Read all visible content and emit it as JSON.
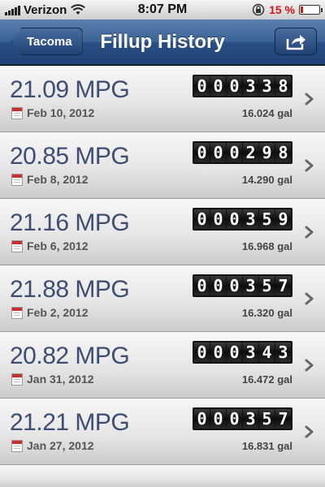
{
  "status_bar": {
    "carrier": "Verizon",
    "time": "8:07 PM",
    "battery_percent": "15 %",
    "battery_level": 0.15,
    "battery_color": "#d01818"
  },
  "nav": {
    "back_label": "Tacoma",
    "title": "Fillup History",
    "share_icon": "share-icon"
  },
  "fillups": [
    {
      "mpg": "21.09 MPG",
      "date": "Feb 10, 2012",
      "odometer": "000338",
      "gallons": "16.024 gal"
    },
    {
      "mpg": "20.85 MPG",
      "date": "Feb 8, 2012",
      "odometer": "000298",
      "gallons": "14.290 gal"
    },
    {
      "mpg": "21.16 MPG",
      "date": "Feb 6, 2012",
      "odometer": "000359",
      "gallons": "16.968 gal"
    },
    {
      "mpg": "21.88 MPG",
      "date": "Feb 2, 2012",
      "odometer": "000357",
      "gallons": "16.320 gal"
    },
    {
      "mpg": "20.82 MPG",
      "date": "Jan 31, 2012",
      "odometer": "000343",
      "gallons": "16.472 gal"
    },
    {
      "mpg": "21.21 MPG",
      "date": "Jan 27, 2012",
      "odometer": "000357",
      "gallons": "16.831 gal"
    }
  ]
}
